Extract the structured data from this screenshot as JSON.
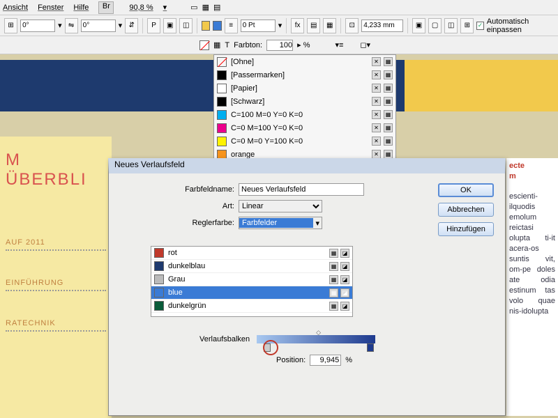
{
  "menu": {
    "ansicht": "Ansicht",
    "fenster": "Fenster",
    "hilfe": "Hilfe",
    "br": "Br",
    "zoom": "90,8 %"
  },
  "toolbar": {
    "angle1": "0°",
    "angle2": "0°",
    "pt": "0 Pt",
    "mm": "4,233 mm",
    "auto": "Automatisch einpassen"
  },
  "tint": {
    "label": "Farbton:",
    "value": "100",
    "unit": "%"
  },
  "swatches": [
    {
      "name": "[Ohne]",
      "color": "transparent",
      "diag": true
    },
    {
      "name": "[Passermarken]",
      "color": "#000"
    },
    {
      "name": "[Papier]",
      "color": "#fff"
    },
    {
      "name": "[Schwarz]",
      "color": "#000"
    },
    {
      "name": "C=100 M=0 Y=0 K=0",
      "color": "#00aeef"
    },
    {
      "name": "C=0 M=100 Y=0 K=0",
      "color": "#ec008c"
    },
    {
      "name": "C=0 M=0 Y=100 K=0",
      "color": "#fff200"
    },
    {
      "name": "orange",
      "color": "#f7941d"
    }
  ],
  "doc": {
    "title": "M ÜBERBLI",
    "l1": "AUF 2011",
    "l2": "EINFÜHRUNG",
    "l3": "RATECHNIK"
  },
  "dialog": {
    "title": "Neues Verlaufsfeld",
    "name_lbl": "Farbfeldname:",
    "name_val": "Neues Verlaufsfeld",
    "art_lbl": "Art:",
    "art_val": "Linear",
    "regler_lbl": "Reglerfarbe:",
    "regler_val": "Farbfelder",
    "vb_lbl": "Verlaufsbalken",
    "pos_lbl": "Position:",
    "pos_val": "9,945",
    "pos_unit": "%",
    "ok": "OK",
    "cancel": "Abbrechen",
    "add": "Hinzufügen"
  },
  "colors": [
    {
      "name": "rot",
      "c": "#c0392b"
    },
    {
      "name": "dunkelblau",
      "c": "#1e3a6e"
    },
    {
      "name": "Grau",
      "c": "#bbb"
    },
    {
      "name": "blue",
      "c": "#3a7bd5",
      "sel": true
    },
    {
      "name": "dunkelgrün",
      "c": "#0a5c3a"
    }
  ],
  "righthead": {
    "a": "ecte",
    "b": "m"
  },
  "righttext": "escienti-ilquodis emolum reictasi olupta ti-it acera-os suntis vit, om-pe doles ate odia estinum tas volo quae nis-idolupta"
}
